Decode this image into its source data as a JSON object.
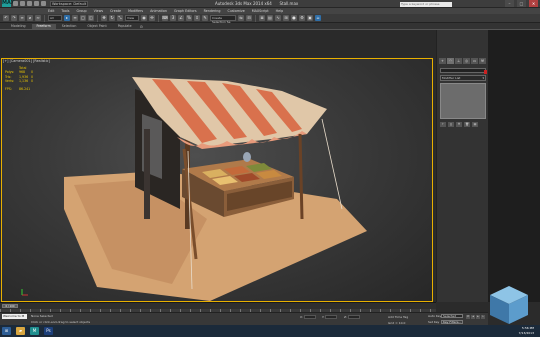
{
  "titlebar": {
    "logo": "MAX",
    "workspace": "Workspace: Default",
    "title": "Autodesk 3ds Max 2014 x64",
    "file": "Stall.max",
    "search_placeholder": "Type a keyword or phrase",
    "minimize": "–",
    "maximize": "□",
    "close": "✕"
  },
  "menu": [
    "Edit",
    "Tools",
    "Group",
    "Views",
    "Create",
    "Modifiers",
    "Animation",
    "Graph Editors",
    "Rendering",
    "Customize",
    "MAXScript",
    "Help"
  ],
  "toolbar": {
    "selection_filter": "All",
    "reference_coord": "View",
    "named_sets": "Create Selection Se"
  },
  "ribbon": {
    "tabs": [
      "Modeling",
      "Freeform",
      "Selection",
      "Object Paint",
      "Populate"
    ],
    "active_index": 1
  },
  "viewport": {
    "label": "[+] [Camera001] [Realistic]",
    "stats": {
      "header": "Total",
      "rows": [
        {
          "label": "Polys:",
          "value": "968",
          "extra": "0"
        },
        {
          "label": "Tris:",
          "value": "1,936",
          "extra": "0"
        },
        {
          "label": "Verts:",
          "value": "1,136",
          "extra": "0"
        }
      ],
      "fps_label": "FPS:",
      "fps_value": "86.241"
    }
  },
  "command_panel": {
    "tabs": [
      "+",
      "◠",
      "⊥",
      "◎",
      "▭",
      "⚒"
    ],
    "active_tab": 1,
    "modifier_list": "Modifier List",
    "stack_buttons": [
      "⊢",
      "‖",
      "∀",
      "🗑",
      "▤"
    ]
  },
  "timeline": {
    "frame": "0 / 100"
  },
  "statusbar": {
    "maxscript_label": "Welcome to M",
    "status_line1": "None Selected",
    "status_line2": "Click or click-and-drag to select objects",
    "x_label": "X:",
    "y_label": "Y:",
    "z_label": "Z:",
    "grid": "Grid = 10.0",
    "add_time_tag": "Add Time Tag",
    "auto_key": "Auto Key",
    "selected": "Selected",
    "set_key": "Set Key",
    "key_filters": "Key Filters..."
  },
  "taskbar": {
    "apps": [
      {
        "name": "Windows",
        "glyph": "⊞",
        "color": "#2d5d95"
      },
      {
        "name": "Explorer",
        "glyph": "▰",
        "color": "#d8a640"
      },
      {
        "name": "3ds Max",
        "glyph": "M",
        "color": "#1f8f8f"
      },
      {
        "name": "Photoshop",
        "glyph": "Ps",
        "color": "#1c3f7a"
      }
    ],
    "time": "5:56 PM",
    "date": "7/13/2013"
  },
  "colors": {
    "viewport_border": "#e8b000",
    "stats_text": "#e8c400",
    "awning_stripe": "#d9714d",
    "awning_cream": "#f2dcc4",
    "ground": "#d7a677"
  }
}
